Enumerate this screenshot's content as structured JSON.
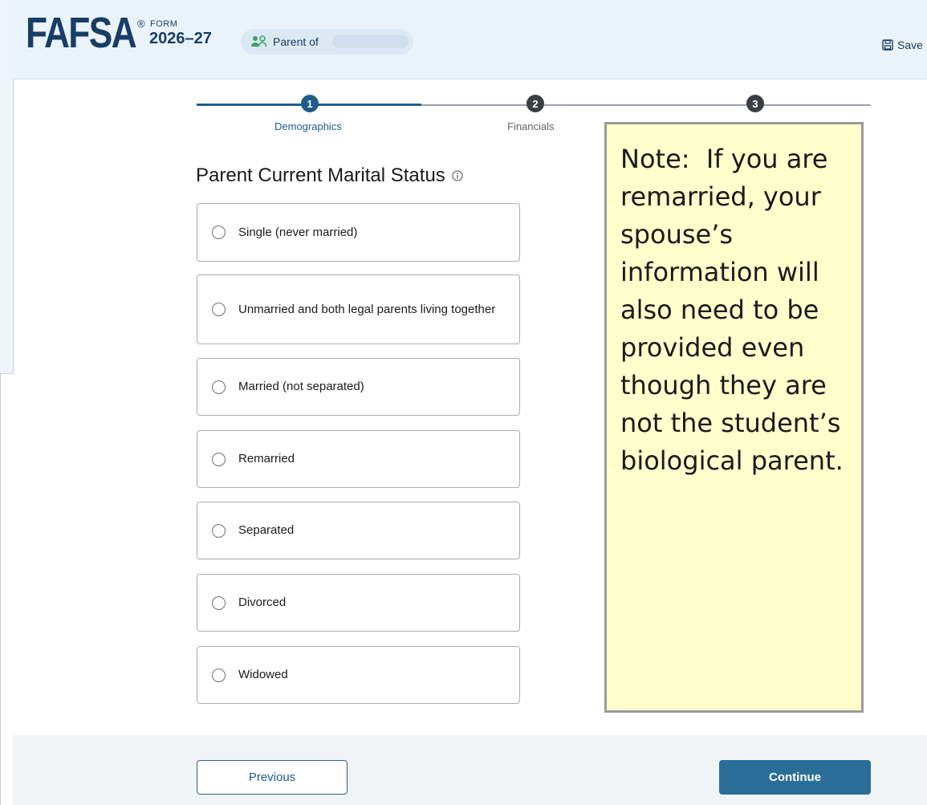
{
  "header": {
    "logo": "FAFSA",
    "registered": "®",
    "form_label": "FORM",
    "form_year": "2026–27",
    "parent_label": "Parent of",
    "save_label": "Save"
  },
  "progress": {
    "steps": [
      {
        "number": "1",
        "label": "Demographics",
        "active": true
      },
      {
        "number": "2",
        "label": "Financials",
        "active": false
      },
      {
        "number": "3",
        "label": "",
        "active": false
      }
    ]
  },
  "main": {
    "title": "Parent Current Marital Status",
    "options": [
      {
        "label": "Single (never married)"
      },
      {
        "label": "Unmarried and both legal parents living together"
      },
      {
        "label": "Married (not separated)"
      },
      {
        "label": "Remarried"
      },
      {
        "label": "Separated"
      },
      {
        "label": "Divorced"
      },
      {
        "label": "Widowed"
      }
    ]
  },
  "footer": {
    "previous_label": "Previous",
    "continue_label": "Continue"
  },
  "note": {
    "prefix": "Note:",
    "text": "If you are remarried, your spouse’s information will also need to be provided even though they are not the student’s biological parent."
  },
  "colors": {
    "primary": "#1f5c8a",
    "header_bg": "#ebf3fa",
    "note_bg": "#ffffcc"
  }
}
